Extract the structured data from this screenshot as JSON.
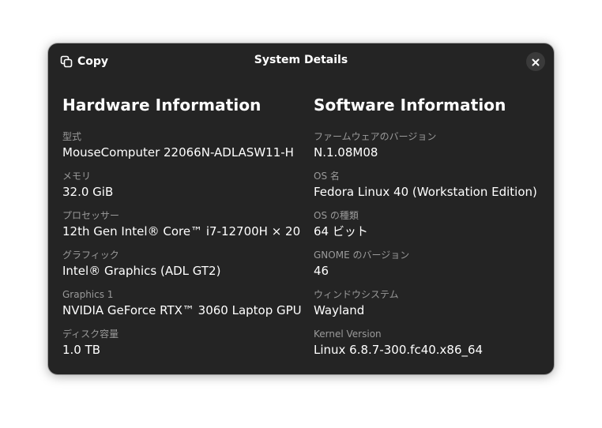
{
  "dialog": {
    "title": "System Details",
    "copy_label": "Copy",
    "close_icon": "close-icon",
    "copy_icon": "copy-icon"
  },
  "hardware": {
    "title": "Hardware Information",
    "items": [
      {
        "label": "型式",
        "value": "MouseComputer 22066N-ADLASW11-H"
      },
      {
        "label": "メモリ",
        "value": "32.0 GiB"
      },
      {
        "label": "プロセッサー",
        "value": "12th Gen Intel® Core™ i7-12700H × 20"
      },
      {
        "label": "グラフィック",
        "value": "Intel® Graphics (ADL GT2)"
      },
      {
        "label": "Graphics 1",
        "value": "NVIDIA GeForce RTX™ 3060 Laptop GPU"
      },
      {
        "label": "ディスク容量",
        "value": "1.0 TB"
      }
    ]
  },
  "software": {
    "title": "Software Information",
    "items": [
      {
        "label": "ファームウェアのバージョン",
        "value": "N.1.08M08"
      },
      {
        "label": "OS 名",
        "value": "Fedora Linux 40 (Workstation Edition)"
      },
      {
        "label": "OS の種類",
        "value": "64 ビット"
      },
      {
        "label": "GNOME のバージョン",
        "value": "46"
      },
      {
        "label": "ウィンドウシステム",
        "value": "Wayland"
      },
      {
        "label": "Kernel Version",
        "value": "Linux 6.8.7-300.fc40.x86_64"
      }
    ]
  }
}
